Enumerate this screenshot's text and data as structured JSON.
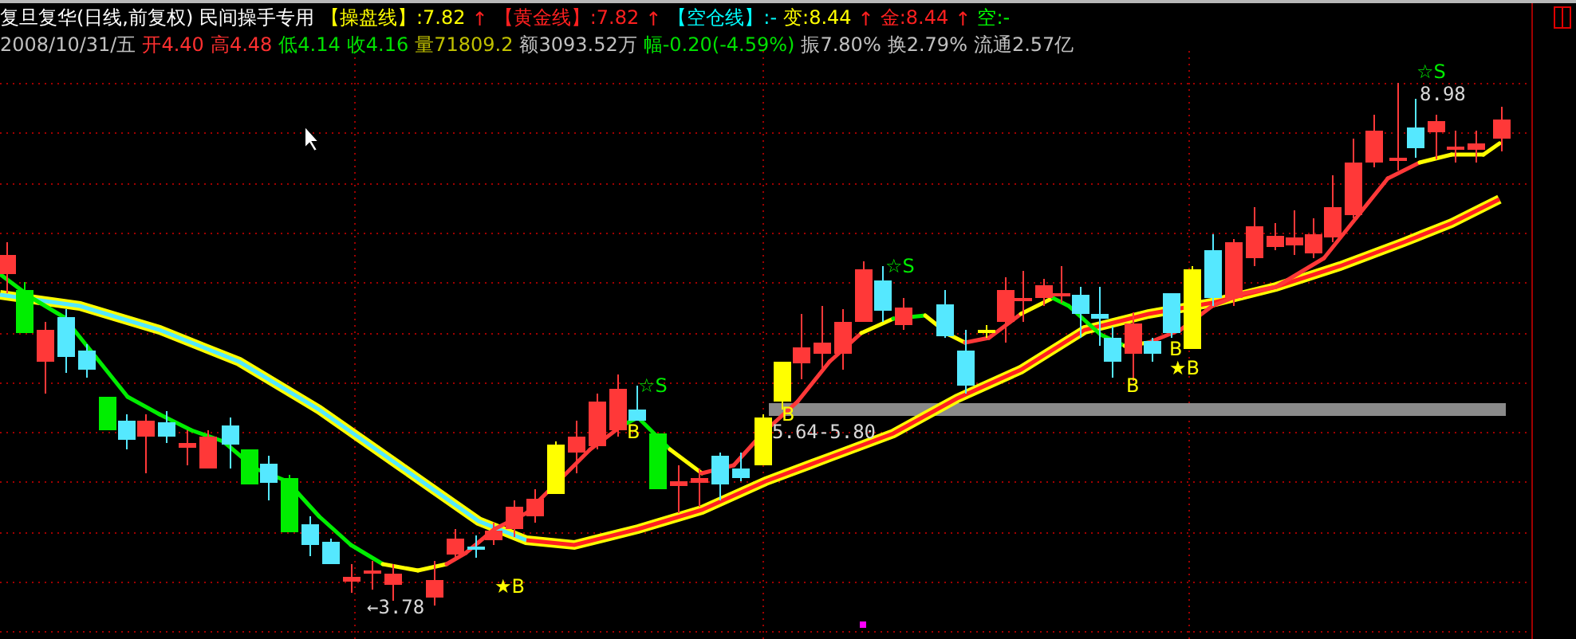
{
  "header": {
    "title_line": [
      {
        "text": "复旦复华(日线,前复权) 民间操手专用",
        "color": "#ffffff"
      },
      {
        "text": "【操盘线】:7.82",
        "color": "#ffff00"
      },
      {
        "text": "↑",
        "color": "#ff2020"
      },
      {
        "text": "【黄金线】:7.82",
        "color": "#ff2020"
      },
      {
        "text": "↑",
        "color": "#ff2020"
      },
      {
        "text": "【空仓线】:-",
        "color": "#00ffff"
      },
      {
        "text": "变:8.44",
        "color": "#ffff00"
      },
      {
        "text": "↑",
        "color": "#ff2020"
      },
      {
        "text": "金:8.44",
        "color": "#ff2020"
      },
      {
        "text": "↑",
        "color": "#ff2020"
      },
      {
        "text": "空:-",
        "color": "#00ff00"
      }
    ],
    "quote_line": [
      {
        "text": "2008/10/31/五",
        "color": "#c0c0c0"
      },
      {
        "text": "开4.40",
        "color": "#ff3030"
      },
      {
        "text": "高4.48",
        "color": "#ff3030"
      },
      {
        "text": "低4.14",
        "color": "#00e000"
      },
      {
        "text": "收4.16",
        "color": "#00e000"
      },
      {
        "text": "量71809.2",
        "color": "#c0c000"
      },
      {
        "text": "额3093.52万",
        "color": "#c0c0c0"
      },
      {
        "text": "幅-0.20(-4.59%)",
        "color": "#00e000"
      },
      {
        "text": "振7.80%",
        "color": "#c0c0c0"
      },
      {
        "text": "换2.79%",
        "color": "#c0c0c0"
      },
      {
        "text": "流通2.57亿",
        "color": "#c0c0c0"
      }
    ]
  },
  "annotations": [
    {
      "text": "←3.78",
      "kind": "price"
    },
    {
      "text": "★B",
      "kind": "buy"
    },
    {
      "text": "B",
      "kind": "buy"
    },
    {
      "text": "☆S",
      "kind": "sell"
    },
    {
      "text": "B",
      "kind": "buy"
    },
    {
      "text": "5.64-5.80",
      "kind": "price"
    },
    {
      "text": "☆S",
      "kind": "sell"
    },
    {
      "text": "B",
      "kind": "buy"
    },
    {
      "text": "B",
      "kind": "buy"
    },
    {
      "text": "★B",
      "kind": "buy"
    },
    {
      "text": "☆S",
      "kind": "sell"
    },
    {
      "text": "8.98",
      "kind": "price"
    }
  ]
}
